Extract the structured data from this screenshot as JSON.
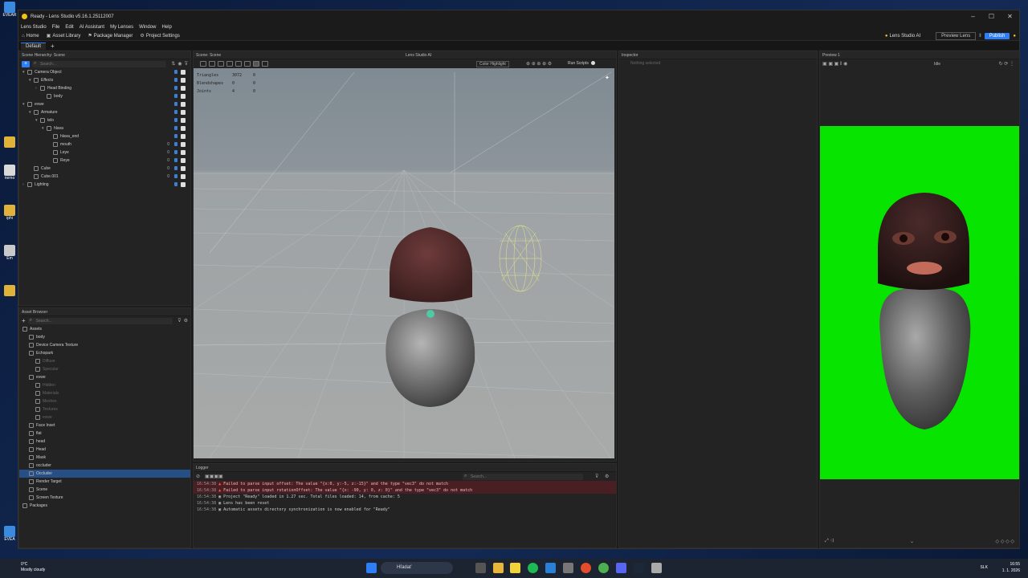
{
  "window": {
    "title": "Ready - Lens Studio v5.16.1.25112007"
  },
  "menu": [
    "Lens Studio",
    "File",
    "Edit",
    "AI Assistant",
    "My Lenses",
    "Window",
    "Help"
  ],
  "toolbar": {
    "home": "Home",
    "asset_library": "Asset Library",
    "package_manager": "Package Manager",
    "project_settings": "Project Settings",
    "lens_studio_ai": "Lens Studio AI",
    "preview_lens": "Preview Lens",
    "publish": "Publish"
  },
  "tabs": {
    "active": "Default"
  },
  "scene_hierarchy": {
    "title": "Scene Hierarchy: Scene",
    "search_placeholder": "Search...",
    "items": [
      {
        "label": "Camera Object",
        "indent": 0,
        "arrow": "▾",
        "num": ""
      },
      {
        "label": "Effects",
        "indent": 1,
        "arrow": "▾",
        "num": ""
      },
      {
        "label": "Head Binding",
        "indent": 2,
        "arrow": "›",
        "num": ""
      },
      {
        "label": "body",
        "indent": 3,
        "arrow": "",
        "num": ""
      },
      {
        "label": "evwe",
        "indent": 0,
        "arrow": "▾",
        "num": ""
      },
      {
        "label": "Armature",
        "indent": 1,
        "arrow": "▾",
        "num": ""
      },
      {
        "label": "telo",
        "indent": 2,
        "arrow": "▾",
        "num": ""
      },
      {
        "label": "hlava",
        "indent": 3,
        "arrow": "▾",
        "num": ""
      },
      {
        "label": "hlava_end",
        "indent": 4,
        "arrow": "",
        "num": ""
      },
      {
        "label": "mouth",
        "indent": 4,
        "arrow": "",
        "num": "0"
      },
      {
        "label": "Leye",
        "indent": 4,
        "arrow": "",
        "num": "0"
      },
      {
        "label": "Reye",
        "indent": 4,
        "arrow": "",
        "num": "0"
      },
      {
        "label": "Cube",
        "indent": 1,
        "arrow": "",
        "num": "0"
      },
      {
        "label": "Cube.001",
        "indent": 1,
        "arrow": "",
        "num": "0"
      },
      {
        "label": "Lighting",
        "indent": 0,
        "arrow": "›",
        "num": ""
      }
    ]
  },
  "asset_browser": {
    "title": "Asset Browser",
    "search_placeholder": "Search...",
    "items": [
      {
        "label": "Assets",
        "indent": 0,
        "dim": false
      },
      {
        "label": "body",
        "indent": 1,
        "dim": false
      },
      {
        "label": "Device Camera Texture",
        "indent": 1,
        "dim": false
      },
      {
        "label": "Echopark",
        "indent": 1,
        "dim": false
      },
      {
        "label": "Diffuse",
        "indent": 2,
        "dim": true
      },
      {
        "label": "Specular",
        "indent": 2,
        "dim": true
      },
      {
        "label": "evwe",
        "indent": 1,
        "dim": false
      },
      {
        "label": "Hidden",
        "indent": 2,
        "dim": true
      },
      {
        "label": "Materials",
        "indent": 2,
        "dim": true
      },
      {
        "label": "Meshes",
        "indent": 2,
        "dim": true
      },
      {
        "label": "Textures",
        "indent": 2,
        "dim": true
      },
      {
        "label": "evwe",
        "indent": 2,
        "dim": true
      },
      {
        "label": "Face Inset",
        "indent": 1,
        "dim": false
      },
      {
        "label": "flat",
        "indent": 1,
        "dim": false
      },
      {
        "label": "head",
        "indent": 1,
        "dim": false
      },
      {
        "label": "Head",
        "indent": 1,
        "dim": false
      },
      {
        "label": "Mask",
        "indent": 1,
        "dim": false
      },
      {
        "label": "occluder",
        "indent": 1,
        "dim": false
      },
      {
        "label": "Occluder",
        "indent": 1,
        "dim": false,
        "sel": true
      },
      {
        "label": "Render Target",
        "indent": 1,
        "dim": false
      },
      {
        "label": "Scene",
        "indent": 1,
        "dim": false
      },
      {
        "label": "Screen Texture",
        "indent": 1,
        "dim": false
      },
      {
        "label": "Packages",
        "indent": 0,
        "dim": false
      }
    ]
  },
  "scene_view": {
    "title": "Scene: Scene",
    "ai_tab": "Lens Studio AI",
    "dropdown": "Color Highlight",
    "run_scripts": "Run Scripts",
    "stats": [
      {
        "key": "Triangles",
        "a": "3072",
        "b": "0"
      },
      {
        "key": "Blendshapes",
        "a": "0",
        "b": "0"
      },
      {
        "key": "Joints",
        "a": "4",
        "b": "0"
      }
    ]
  },
  "inspector": {
    "title": "Inspector",
    "empty": "Nothing selected"
  },
  "preview": {
    "title": "Preview 1",
    "state": "Idle"
  },
  "logger": {
    "title": "Logger",
    "search_placeholder": "Search...",
    "lines": [
      {
        "type": "err",
        "time": "16:54:38",
        "text": "Failed to parse input offset: The value \"{x:0, y:-5, z:-15}\" and the type \"vec3\" do not match"
      },
      {
        "type": "err",
        "time": "16:54:38",
        "text": "Failed to parse input rotationOffset: The value \"{x: -90, y: 0, z: 0}\" and the type \"vec3\" do not match"
      },
      {
        "type": "info",
        "time": "16:54:38",
        "text": "Project \"Ready\" loaded in 1.27 sec. Total files loaded: 14, from cache: 5"
      },
      {
        "type": "info",
        "time": "16:54:38",
        "text": "Lens has been reset"
      },
      {
        "type": "info",
        "time": "16:54:38",
        "text": "Automatic assets directory synchronization is now enabled for \"Ready\""
      }
    ]
  },
  "taskbar": {
    "weather_temp": "0°C",
    "weather_desc": "Mostly cloudy",
    "search": "Hľadať",
    "lang": "SLK",
    "time": "16:55",
    "date": "1. 1. 2026"
  },
  "desktop_icons": [
    "Ki",
    "EVEAR",
    "nemo",
    "iphi",
    "Em",
    "EVEA"
  ]
}
